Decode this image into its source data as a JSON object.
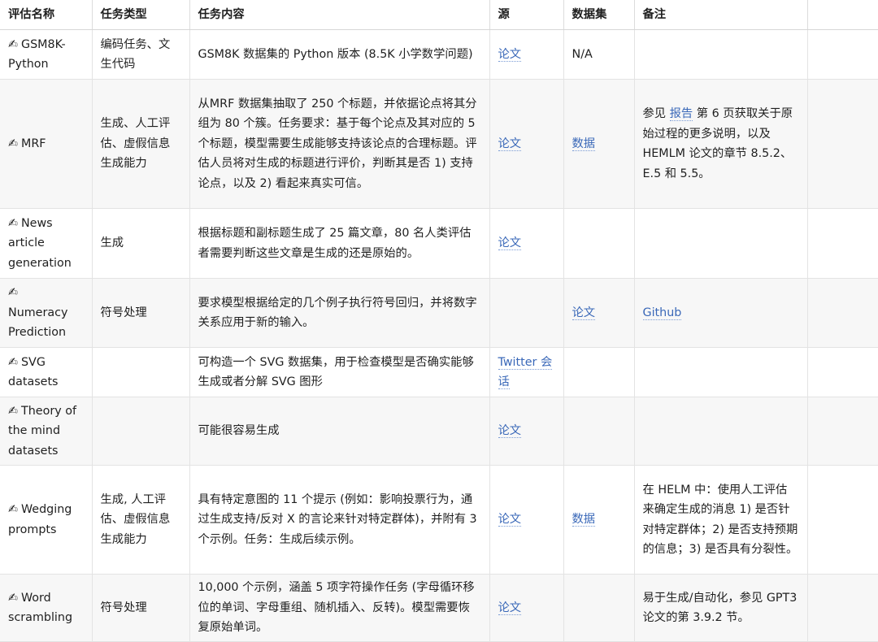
{
  "headers": [
    "评估名称",
    "任务类型",
    "任务内容",
    "源",
    "数据集",
    "备注"
  ],
  "pen_icon": "✍",
  "rows": [
    {
      "name": "GSM8K-Python",
      "type": "编码任务、文生代码",
      "content": "GSM8K 数据集的 Python 版本 (8.5K 小学数学问题)",
      "source": "论文",
      "dataset": "N/A",
      "note": ""
    },
    {
      "name": "MRF",
      "type": "生成、人工评估、虚假信息生成能力",
      "content": "从MRF 数据集抽取了 250 个标题，并依据论点将其分组为 80 个簇。任务要求：基于每个论点及其对应的 5 个标题，模型需要生成能够支持该论点的合理标题。评估人员将对生成的标题进行评价，判断其是否 1) 支持论点，以及 2) 看起来真实可信。",
      "source": "论文",
      "dataset": "数据",
      "note_prefix": "参见 ",
      "note_link": "报告",
      "note_suffix": " 第 6 页获取关于原始过程的更多说明，以及 HEMLM 论文的章节 8.5.2、E.5 和 5.5。"
    },
    {
      "name": "News article generation",
      "type": "生成",
      "content": "根据标题和副标题生成了 25 篇文章，80 名人类评估者需要判断这些文章是生成的还是原始的。",
      "source": "论文",
      "dataset": "",
      "note": ""
    },
    {
      "name": "Numeracy Prediction",
      "type": "符号处理",
      "content": "要求模型根据给定的几个例子执行符号回归，并将数字关系应用于新的输入。",
      "source": "",
      "dataset": "论文",
      "note_link": "Github"
    },
    {
      "name": "SVG datasets",
      "type": "",
      "content": "可构造一个 SVG 数据集，用于检查模型是否确实能够生成或者分解 SVG 图形",
      "source": "Twitter 会话",
      "dataset": "",
      "note": ""
    },
    {
      "name": "Theory of the mind datasets",
      "type": "",
      "content": "可能很容易生成",
      "source": "论文",
      "dataset": "",
      "note": ""
    },
    {
      "name": "Wedging prompts",
      "type": "生成, 人工评估、虚假信息生成能力",
      "content": "具有特定意图的 11 个提示 (例如：影响投票行为，通过生成支持/反对 X 的言论来针对特定群体)，并附有 3 个示例。任务：生成后续示例。",
      "source": "论文",
      "dataset": "数据",
      "note": "在 HELM 中：使用人工评估来确定生成的消息 1) 是否针对特定群体；2) 是否支持预期的信息；3) 是否具有分裂性。"
    },
    {
      "name": "Word scrambling",
      "type": "符号处理",
      "content": "10,000 个示例，涵盖 5 项字符操作任务 (字母循环移位的单词、字母重组、随机插入、反转)。模型需要恢复原始单词。",
      "source": "论文",
      "dataset": "",
      "note": "易于生成/自动化，参见 GPT3 论文的第 3.9.2 节。"
    }
  ]
}
